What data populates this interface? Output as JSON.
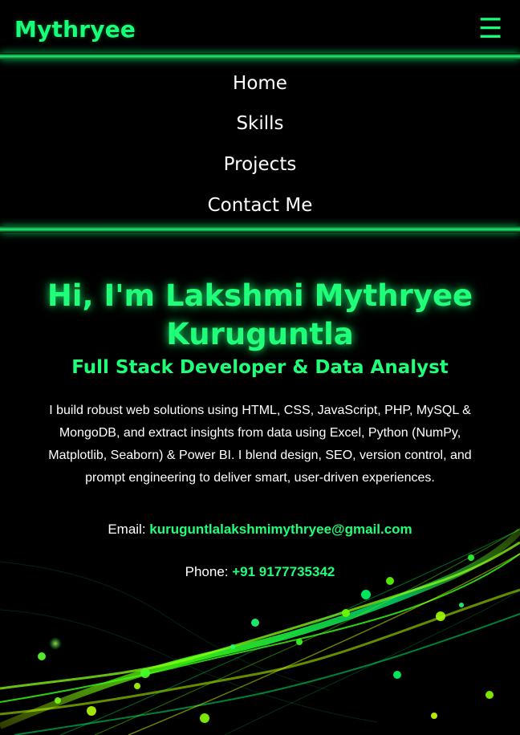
{
  "header": {
    "logo": "Mythryee",
    "menu_icon": "hamburger-menu-icon",
    "accent_color": "#16ff7b"
  },
  "nav": {
    "items": [
      {
        "label": "Home"
      },
      {
        "label": "Skills"
      },
      {
        "label": "Projects"
      },
      {
        "label": "Contact Me"
      }
    ]
  },
  "hero": {
    "title": "Hi, I'm Lakshmi Mythryee Kuruguntla",
    "subtitle": "Full Stack Developer & Data Analyst",
    "bio": "I build robust web solutions using HTML, CSS, JavaScript, PHP, MySQL & MongoDB, and extract insights from data using Excel, Python (NumPy, Matplotlib, Seaborn) & Power BI. I blend design, SEO, version control, and prompt engineering to deliver smart, user-driven experiences.",
    "email_label": "Email:",
    "email_value": "kuruguntlalakshmimythryee@gmail.com",
    "phone_label": "Phone:",
    "phone_value": "+91 9177735342"
  },
  "colors": {
    "background": "#000000",
    "text": "#ffffff",
    "accent": "#1fff79"
  }
}
